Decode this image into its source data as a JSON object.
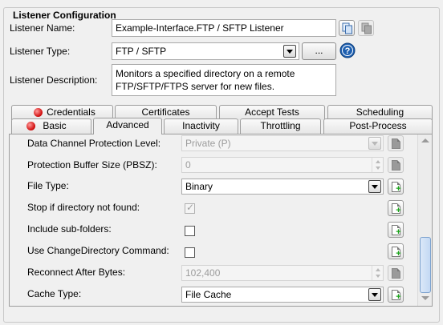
{
  "group_title": "Listener Configuration",
  "listener_name": {
    "label": "Listener Name:",
    "value": "Example-Interface.FTP / SFTP Listener"
  },
  "listener_type": {
    "label": "Listener Type:",
    "value": "FTP / SFTP",
    "browse_label": "..."
  },
  "listener_description": {
    "label": "Listener Description:",
    "line1": "Monitors a specified directory on a remote",
    "line2": "FTP/SFTP/FTPS server for new files."
  },
  "tabs_row1": [
    "Credentials",
    "Certificates",
    "Accept Tests",
    "Scheduling"
  ],
  "tabs_row2": [
    "Basic",
    "Advanced",
    "Inactivity",
    "Throttling",
    "Post-Process"
  ],
  "advanced": {
    "data_channel": {
      "label": "Data Channel Protection Level:",
      "value": "Private (P)"
    },
    "pbsz": {
      "label": "Protection Buffer Size (PBSZ):",
      "value": "0"
    },
    "file_type": {
      "label": "File Type:",
      "value": "Binary"
    },
    "stop_if_missing": {
      "label": "Stop if directory not found:",
      "checked": true
    },
    "include_subfolders": {
      "label": "Include sub-folders:",
      "checked": false
    },
    "use_cd": {
      "label": "Use ChangeDirectory Command:",
      "checked": false
    },
    "reconnect": {
      "label": "Reconnect After Bytes:",
      "value": "102,400"
    },
    "cache_type": {
      "label": "Cache Type:",
      "value": "File Cache"
    }
  },
  "colors": {
    "help_icon": "#1d5fb0",
    "error_dot": "#d31111",
    "add_plus": "#1aa51a",
    "scroll_thumb": "#c3d8f3"
  },
  "icons": {
    "copy": "copy-icon",
    "paste": "paste-icon",
    "help": "help-icon",
    "error": "error-indicator-icon",
    "add_property": "add-property-icon"
  }
}
